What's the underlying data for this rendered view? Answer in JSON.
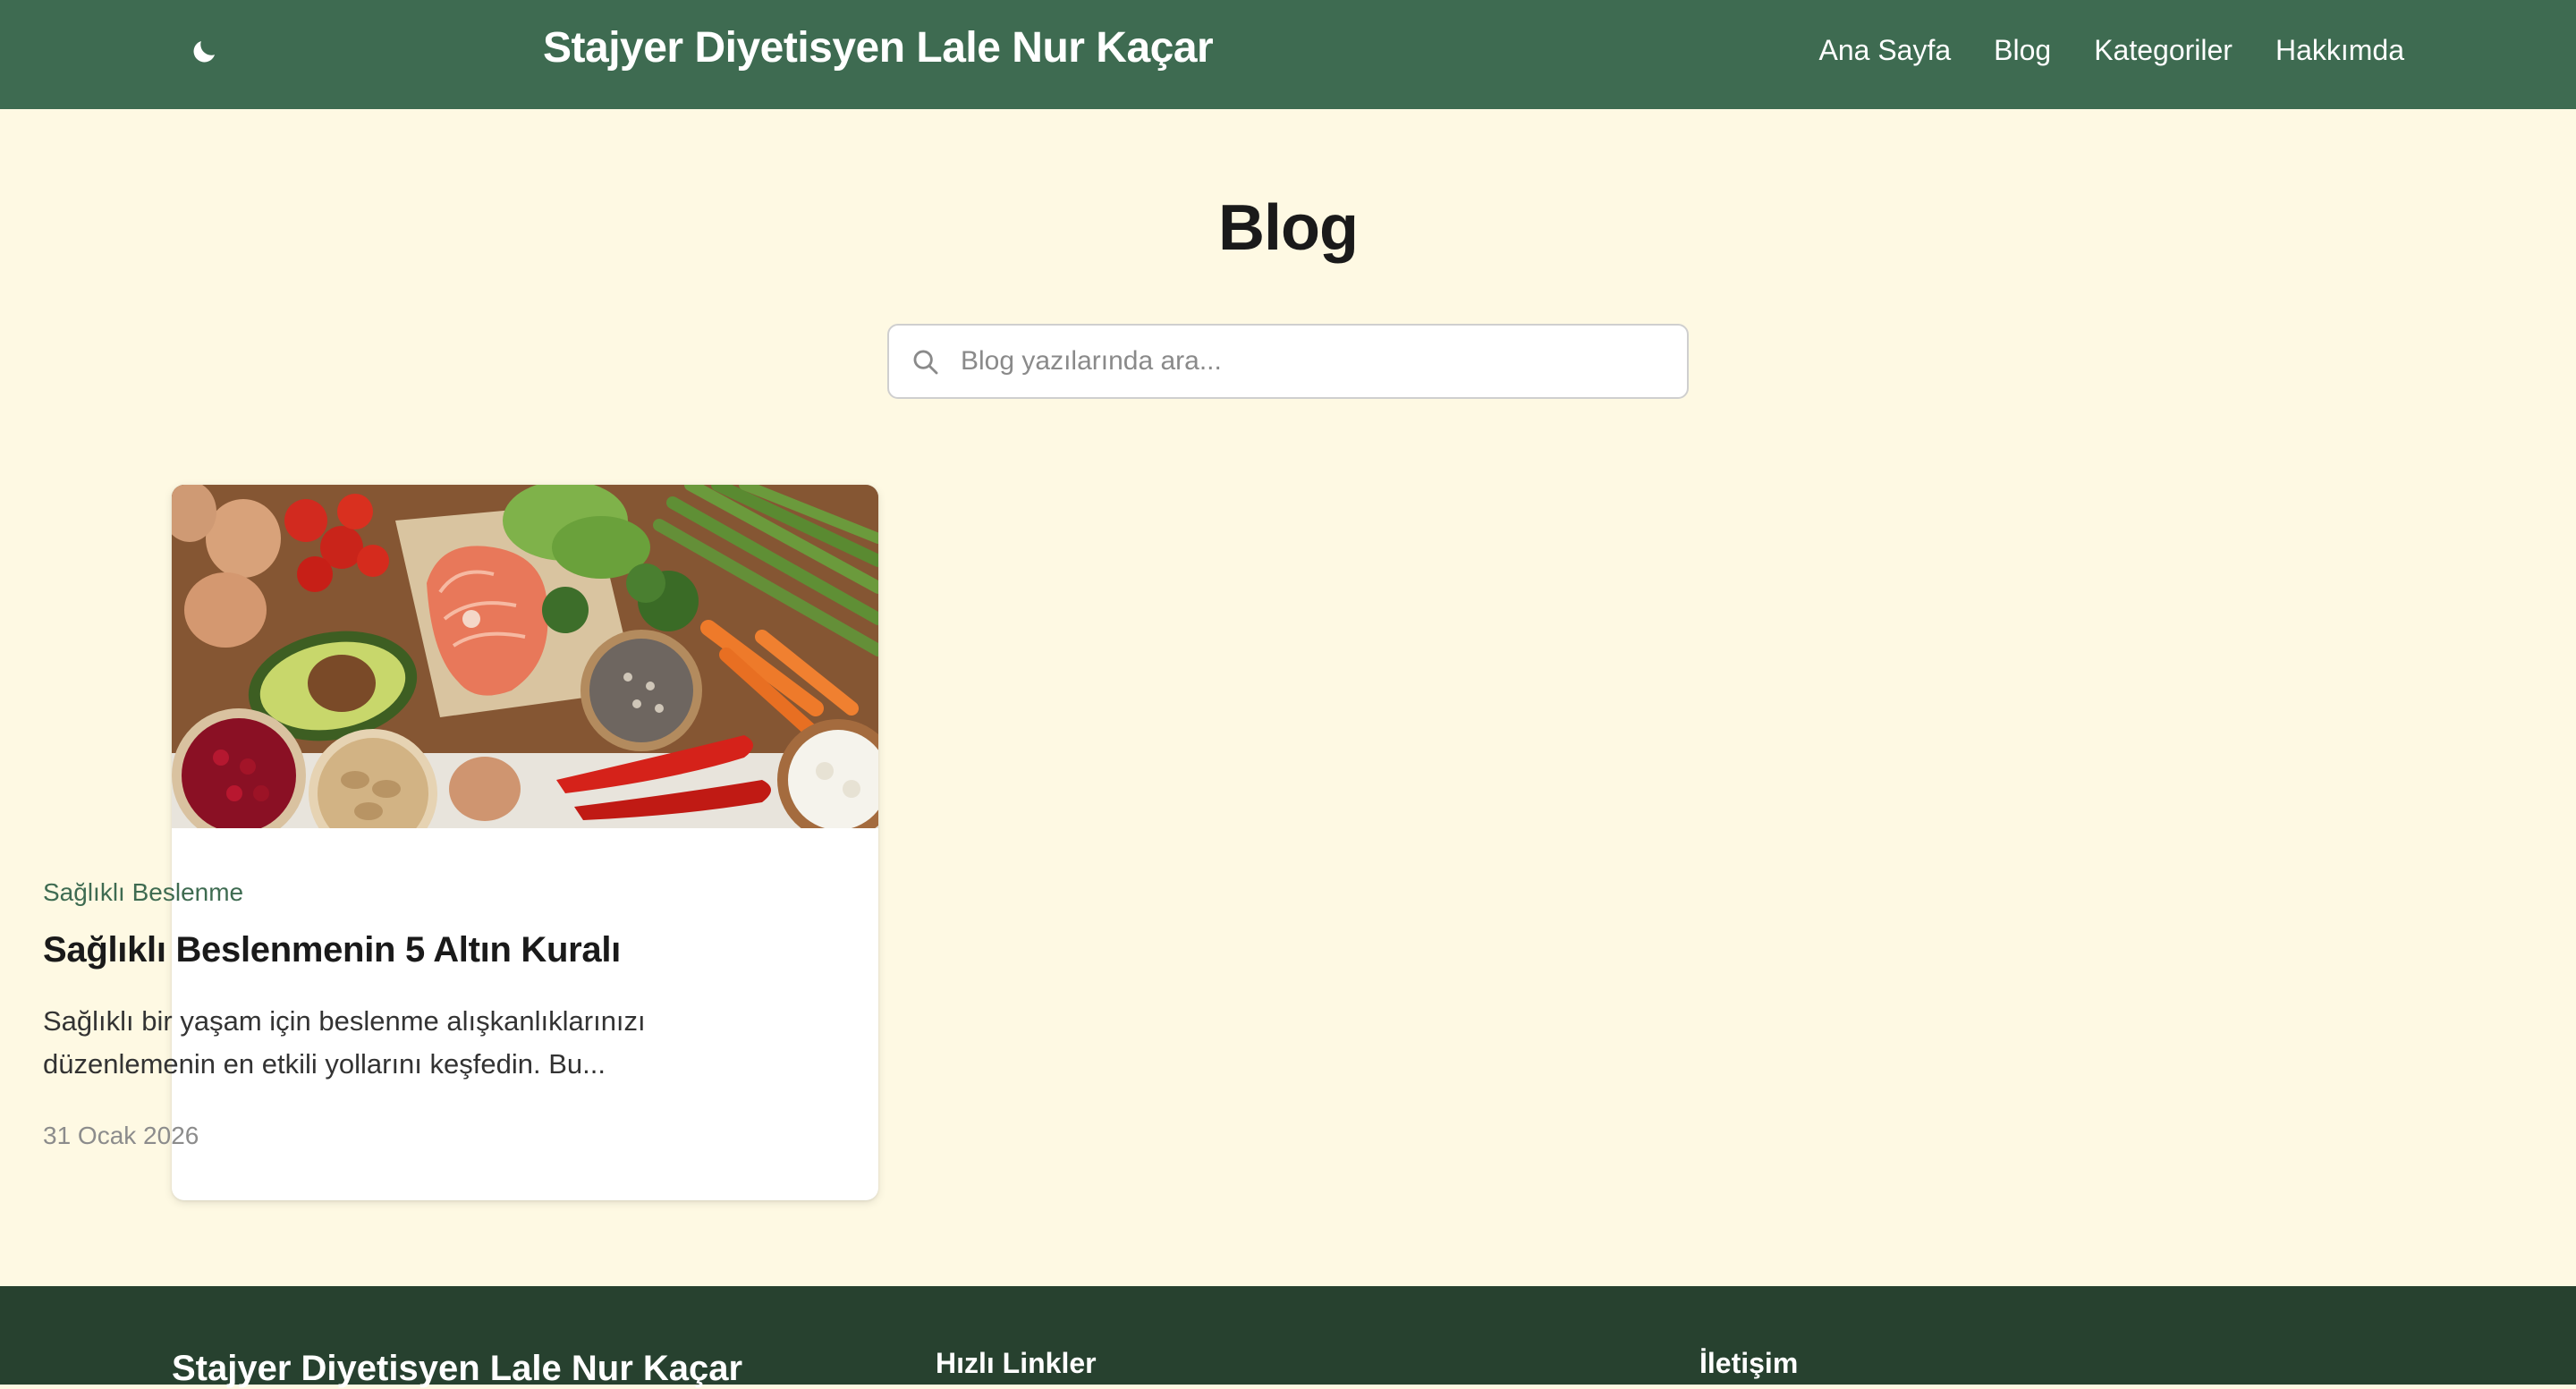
{
  "header": {
    "site_title": "Stajyer Diyetisyen Lale Nur Kaçar",
    "theme_icon": "moon-icon",
    "nav": [
      {
        "label": "Ana Sayfa"
      },
      {
        "label": "Blog"
      },
      {
        "label": "Kategoriler"
      },
      {
        "label": "Hakkımda"
      }
    ]
  },
  "main": {
    "heading": "Blog",
    "search": {
      "placeholder": "Blog yazılarında ara...",
      "value": "",
      "icon": "search-icon"
    }
  },
  "posts": [
    {
      "category": "Sağlıklı Beslenme",
      "title": "Sağlıklı Beslenmenin 5 Altın Kuralı",
      "excerpt": "Sağlıklı bir yaşam için beslenme alışkanlıklarınızı düzenlemenin en etkili yollarını keşfedin. Bu...",
      "date": "31 Ocak 2026"
    }
  ],
  "footer": {
    "brand": "Stajyer Diyetisyen Lale Nur Kaçar",
    "quick_links_title": "Hızlı Linkler",
    "contact_title": "İletişim"
  },
  "colors": {
    "header_bg": "#3e6b51",
    "page_bg": "#fef9e3",
    "accent": "#3e6b51",
    "footer_bg": "#27412f"
  }
}
